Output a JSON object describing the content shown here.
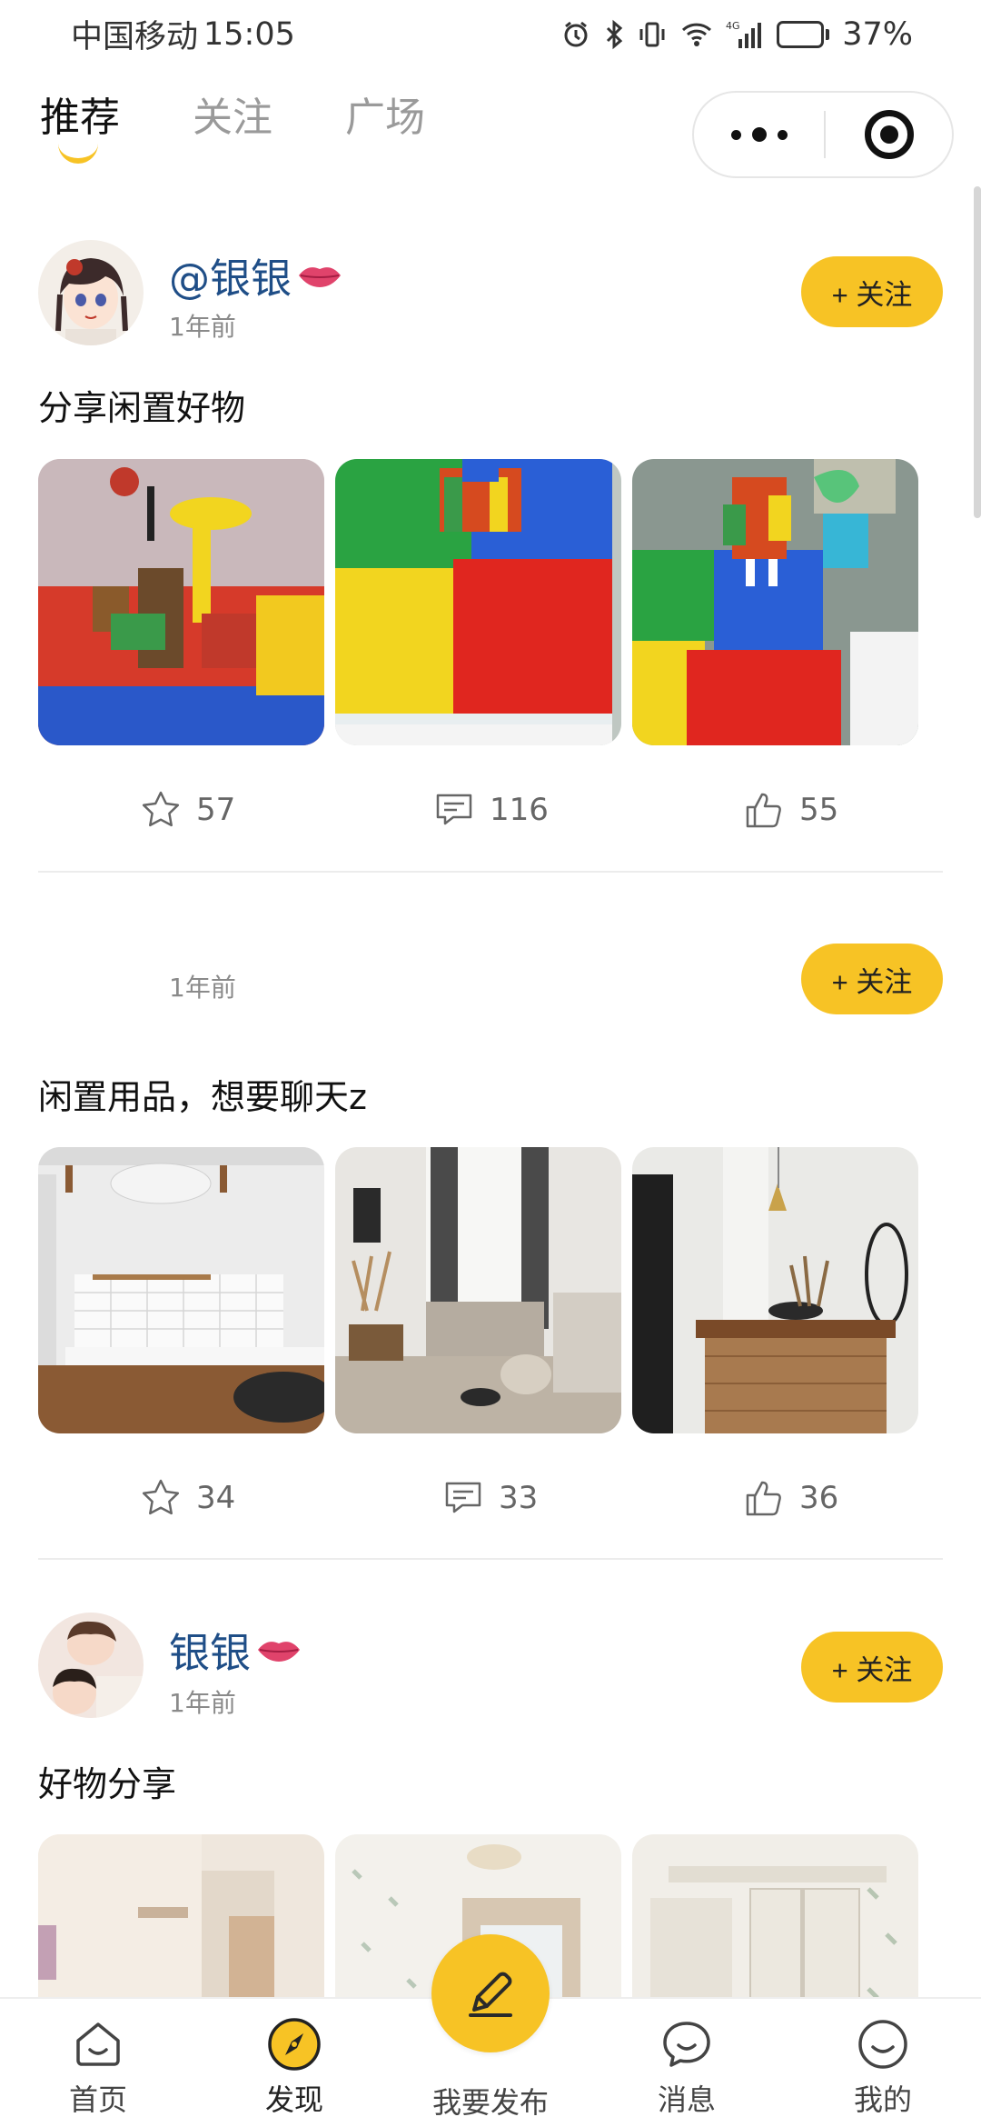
{
  "status_bar": {
    "carrier": "中国移动",
    "time": "15:05",
    "network": "4G",
    "battery_percent": "37%",
    "battery_level": 0.37
  },
  "top_tabs": [
    {
      "label": "推荐",
      "active": true
    },
    {
      "label": "关注",
      "active": false
    },
    {
      "label": "广场",
      "active": false
    }
  ],
  "accent_color": "#f7c325",
  "feed": [
    {
      "username": "@银银",
      "time_ago": "1年前",
      "follow_label": "+ 关注",
      "text": "分享闲置好物",
      "photos": [
        "lego-table-photo",
        "lego-table-photo",
        "lego-table-photo"
      ],
      "stats": {
        "favorites": "57",
        "comments": "116",
        "likes": "55"
      }
    },
    {
      "username": "",
      "time_ago": "1年前",
      "follow_label": "+ 关注",
      "text": "闲置用品，想要聊天z",
      "photos": [
        "kitchen-photo",
        "living-room-photo",
        "kitchen-bar-photo"
      ],
      "stats": {
        "favorites": "34",
        "comments": "33",
        "likes": "36"
      }
    },
    {
      "username": "银银",
      "time_ago": "1年前",
      "follow_label": "+ 关注",
      "text": "好物分享",
      "photos": [
        "room-photo",
        "bedroom-photo",
        "closet-photo"
      ],
      "stats": {}
    }
  ],
  "bottom_nav": [
    {
      "label": "首页",
      "icon": "home-icon"
    },
    {
      "label": "发现",
      "icon": "compass-icon",
      "active": true
    },
    {
      "label": "我要发布",
      "icon": "pencil-icon"
    },
    {
      "label": "消息",
      "icon": "chat-icon"
    },
    {
      "label": "我的",
      "icon": "profile-icon"
    }
  ]
}
